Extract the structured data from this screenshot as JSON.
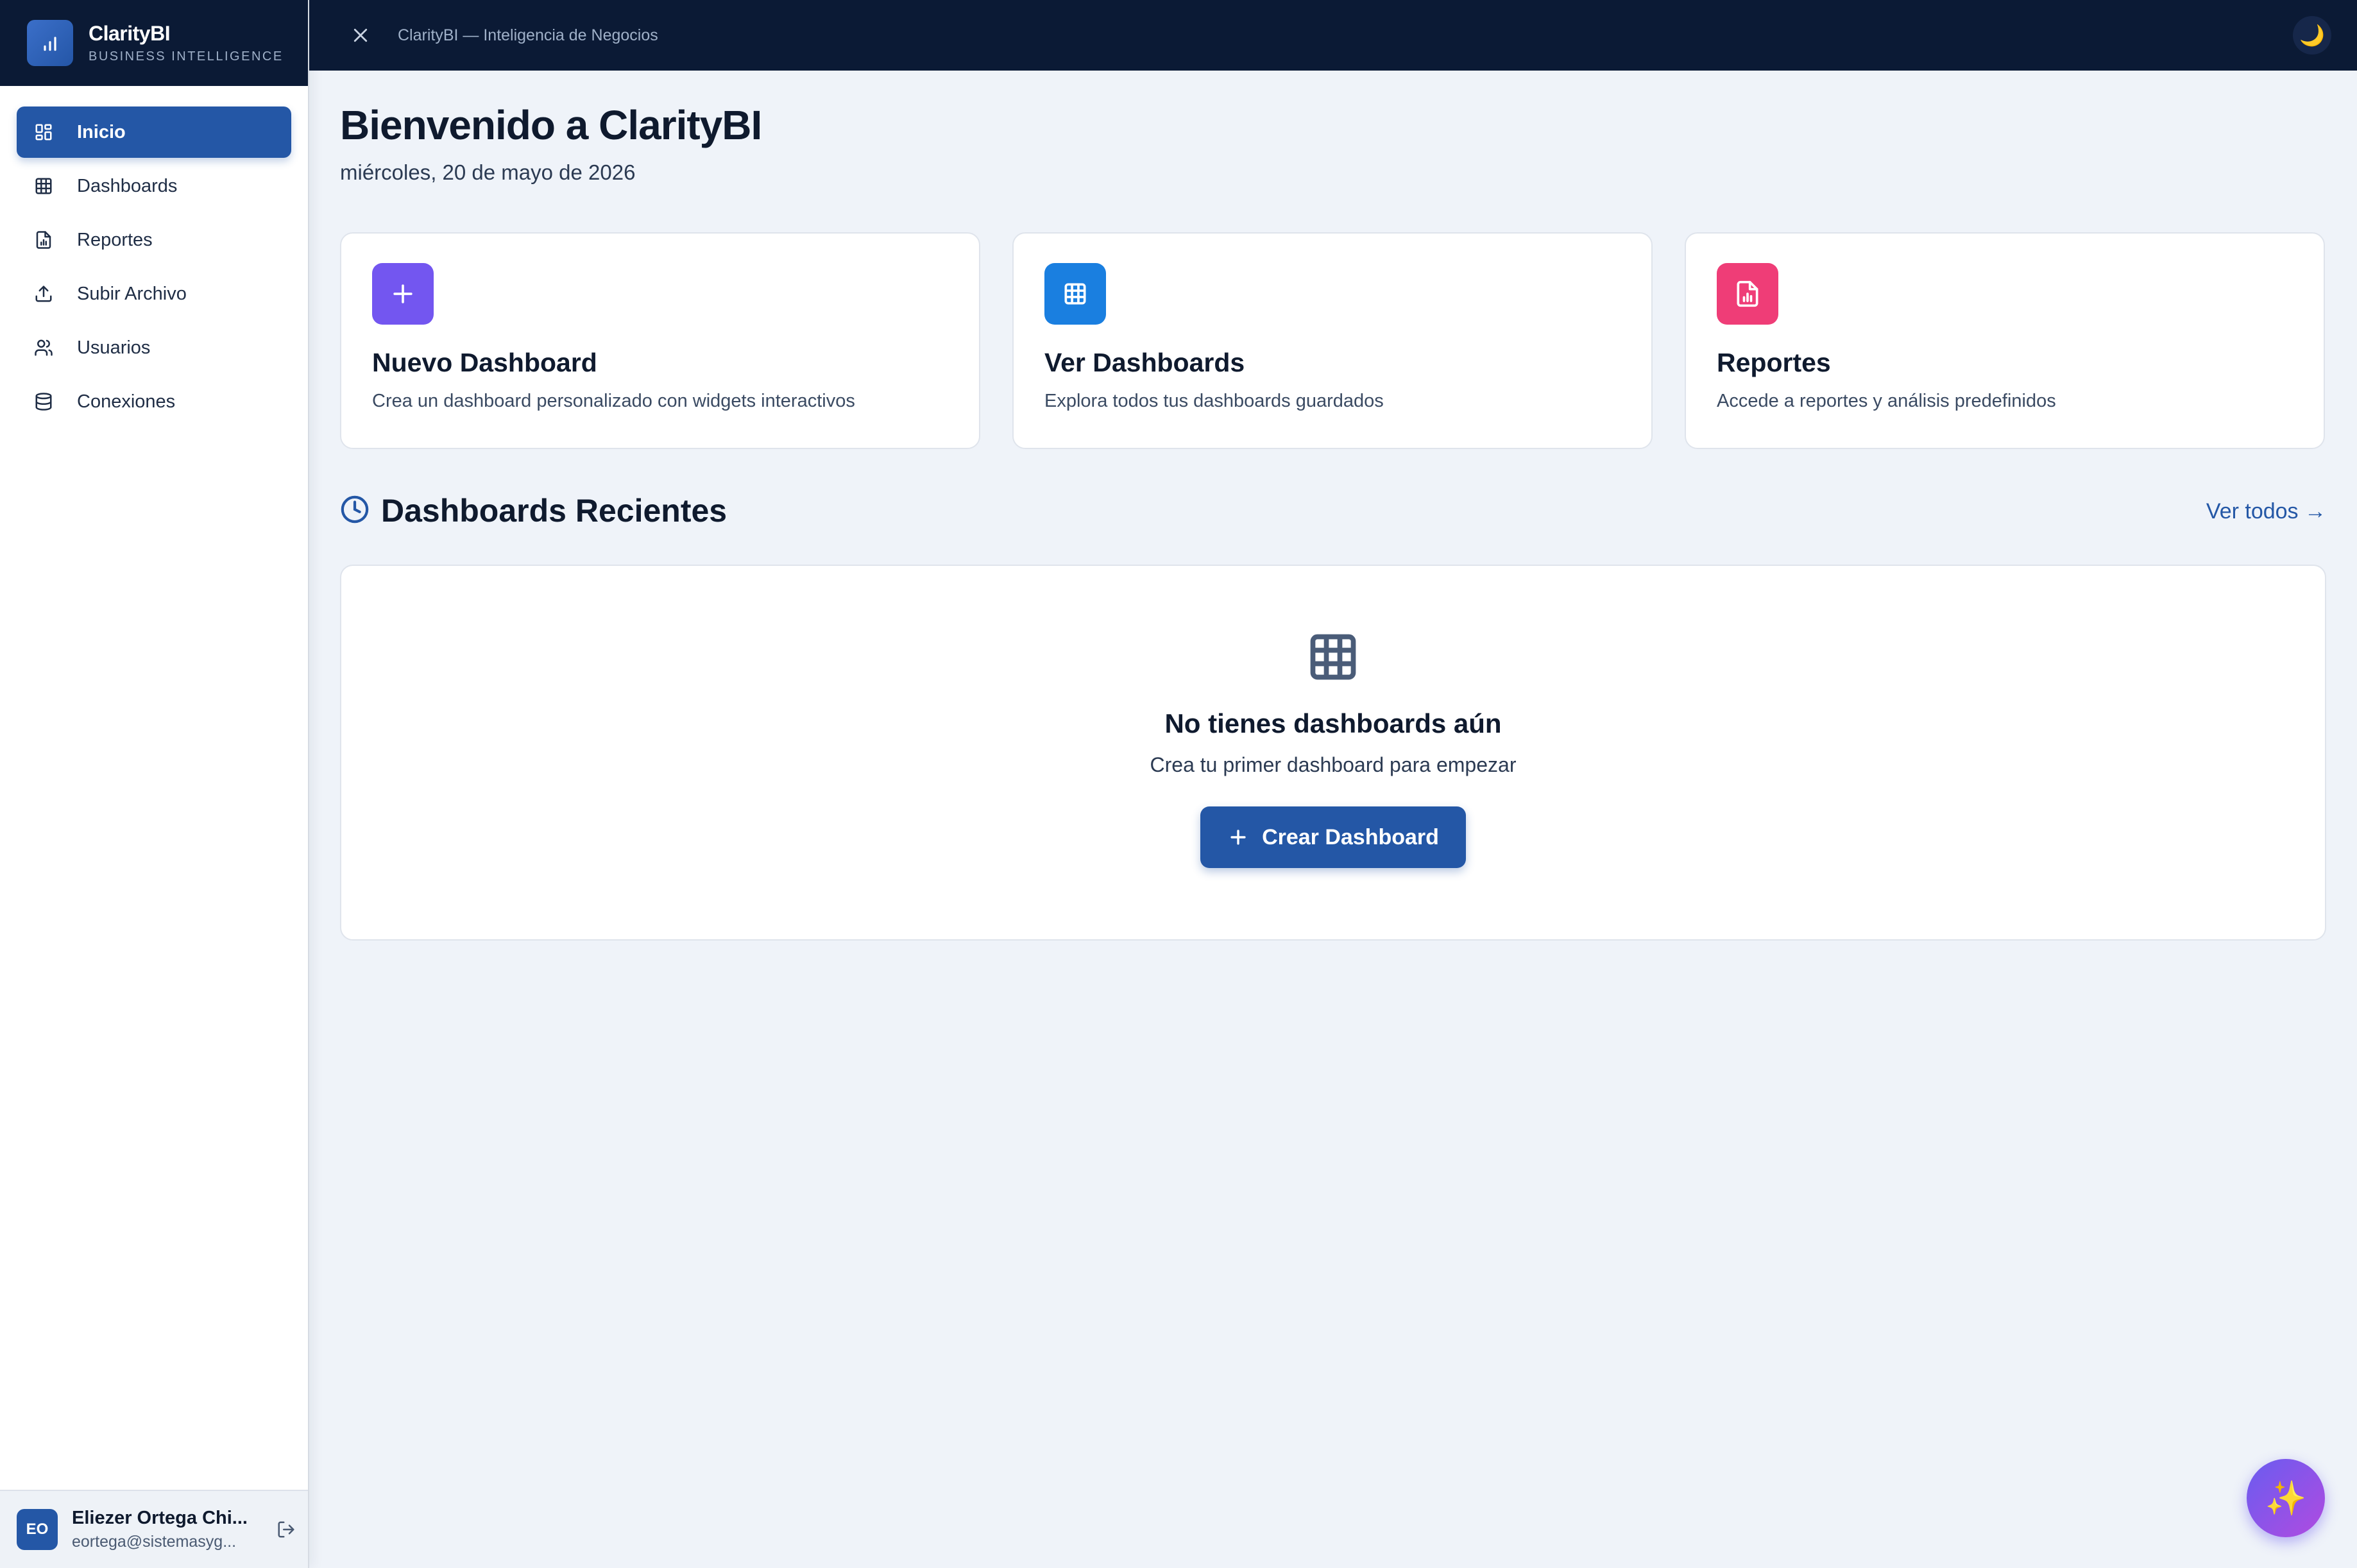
{
  "app": {
    "name": "ClarityBI",
    "subtitle": "BUSINESS INTELLIGENCE",
    "window_title": "ClarityBI — Inteligencia de Negocios"
  },
  "sidebar": {
    "items": [
      {
        "label": "Inicio",
        "icon": "layout-grid-icon",
        "active": true
      },
      {
        "label": "Dashboards",
        "icon": "table-grid-icon",
        "active": false
      },
      {
        "label": "Reportes",
        "icon": "file-chart-icon",
        "active": false
      },
      {
        "label": "Subir Archivo",
        "icon": "upload-icon",
        "active": false
      },
      {
        "label": "Usuarios",
        "icon": "users-icon",
        "active": false
      },
      {
        "label": "Conexiones",
        "icon": "database-icon",
        "active": false
      }
    ],
    "user": {
      "initials": "EO",
      "name": "Eliezer Ortega Chi...",
      "email": "eortega@sistemasyg..."
    }
  },
  "topbar": {
    "theme_icon": "🌙"
  },
  "main": {
    "title": "Bienvenido a ClarityBI",
    "date": "miércoles, 20 de mayo de 2026",
    "cards": [
      {
        "title": "Nuevo Dashboard",
        "description": "Crea un dashboard personalizado con widgets interactivos",
        "color": "#7356f0",
        "icon": "plus-icon"
      },
      {
        "title": "Ver Dashboards",
        "description": "Explora todos tus dashboards guardados",
        "color": "#1a7fe0",
        "icon": "table-grid-icon"
      },
      {
        "title": "Reportes",
        "description": "Accede a reportes y análisis predefinidos",
        "color": "#ef3d77",
        "icon": "file-chart-icon"
      }
    ],
    "recent": {
      "title": "Dashboards Recientes",
      "see_all": "Ver todos →",
      "empty_title": "No tienes dashboards aún",
      "empty_subtitle": "Crea tu primer dashboard para empezar",
      "cta": "Crear Dashboard"
    }
  },
  "fab": {
    "icon": "✨"
  },
  "colors": {
    "primary": "#2457a6",
    "dark_header": "#0b1a35",
    "background": "#eff3f9"
  }
}
